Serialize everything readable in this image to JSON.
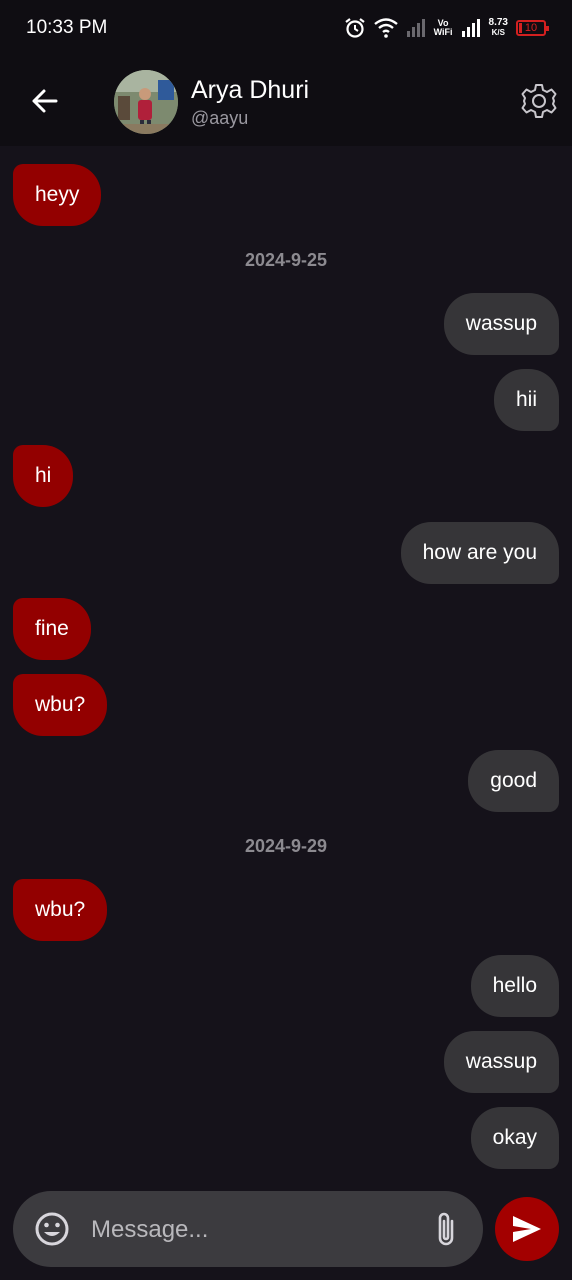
{
  "status_bar": {
    "time": "10:33 PM",
    "vo_wifi_top": "Vo",
    "vo_wifi_bottom": "WiFi",
    "net_speed_value": "8.73",
    "net_speed_unit": "K/S",
    "battery_level": "10",
    "battery_color": "#d32020"
  },
  "header": {
    "contact_name": "Arya Dhuri",
    "contact_handle": "@aayu",
    "icons": [
      "arrow-left-icon",
      "gear-icon"
    ]
  },
  "messages": [
    {
      "direction": "in",
      "text": "heyy"
    },
    {
      "date": "2024-9-25"
    },
    {
      "direction": "out",
      "text": "wassup"
    },
    {
      "direction": "out",
      "text": "hii"
    },
    {
      "direction": "in",
      "text": "hi"
    },
    {
      "direction": "out",
      "text": "how are you"
    },
    {
      "direction": "in",
      "text": "fine"
    },
    {
      "direction": "in",
      "text": "wbu?"
    },
    {
      "direction": "out",
      "text": "good"
    },
    {
      "date": "2024-9-29"
    },
    {
      "direction": "in",
      "text": "wbu?"
    },
    {
      "direction": "out",
      "text": "hello"
    },
    {
      "direction": "out",
      "text": "wassup"
    },
    {
      "direction": "out",
      "text": "okay"
    }
  ],
  "composer": {
    "placeholder": "Message...",
    "value": "",
    "icons": [
      "emoji-icon",
      "paperclip-icon",
      "send-icon"
    ]
  },
  "colors": {
    "incoming_bubble": "#930000",
    "outgoing_bubble": "#363538",
    "background": "#15121a",
    "send_button": "#a30000"
  }
}
